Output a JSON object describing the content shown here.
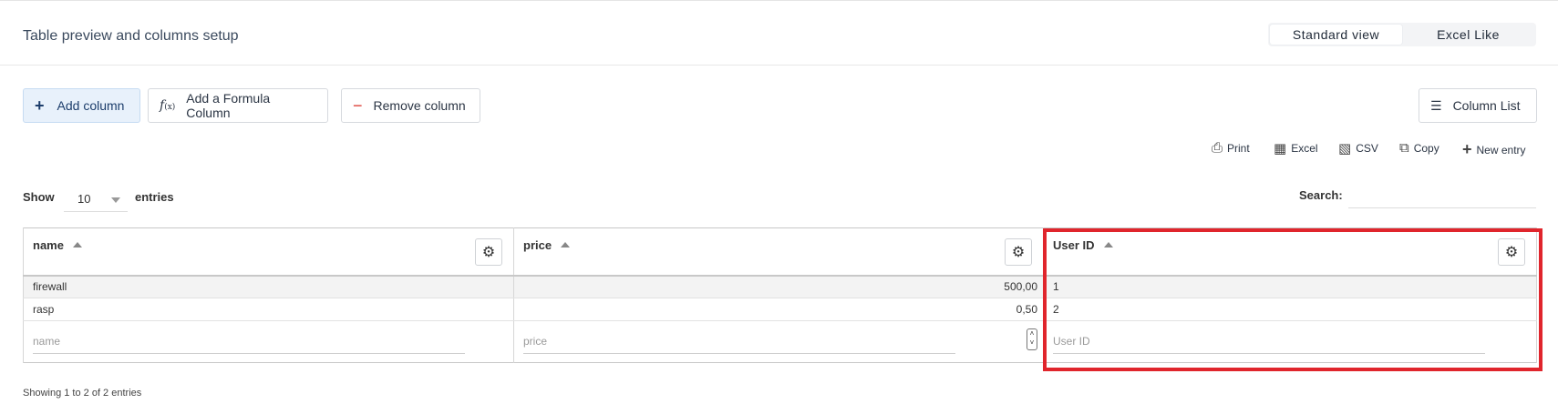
{
  "header": {
    "title": "Table preview and columns setup",
    "views": [
      "Standard view",
      "Excel Like"
    ],
    "active_view": "Standard view"
  },
  "toolbar": {
    "add_column": "Add column",
    "add_formula": "Add a Formula Column",
    "remove_column": "Remove column",
    "column_list": "Column List"
  },
  "exports": {
    "print": "Print",
    "excel": "Excel",
    "csv": "CSV",
    "copy": "Copy",
    "new_entry": "New entry"
  },
  "length": {
    "show": "Show",
    "value": "10",
    "entries": "entries"
  },
  "search": {
    "label": "Search:",
    "value": ""
  },
  "table": {
    "columns": [
      "name",
      "price",
      "User ID"
    ],
    "rows": [
      [
        "firewall",
        "500,00",
        "1"
      ],
      [
        "rasp",
        "0,50",
        "2"
      ]
    ],
    "placeholders": [
      "name",
      "price",
      "User ID"
    ]
  },
  "info": "Showing 1 to 2 of 2 entries",
  "colors": {
    "highlight": "#e0252c",
    "primary_bg": "#e8f1fb",
    "remove_icon": "#d9342b"
  }
}
